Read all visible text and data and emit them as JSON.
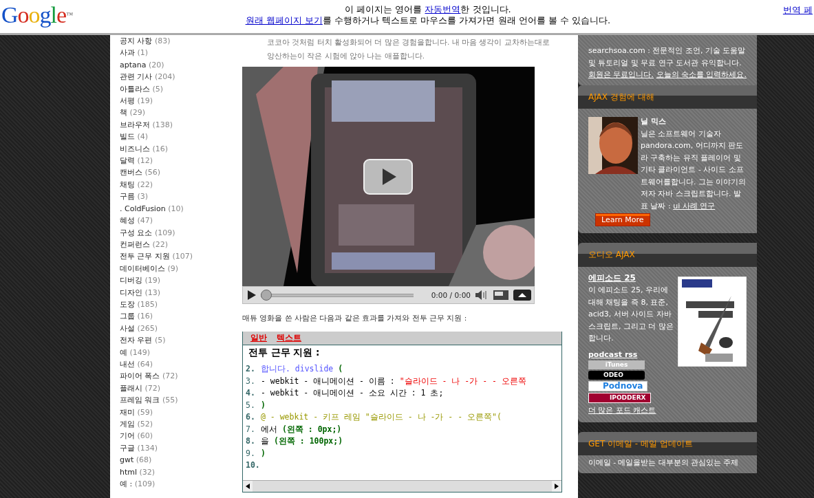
{
  "header": {
    "logo": "Google",
    "logo_mark": "™",
    "notice": [
      [
        {
          "kind": "text",
          "text": "이 페이지는 영어를 "
        },
        {
          "kind": "link",
          "text": "자동번역"
        },
        {
          "kind": "text",
          "text": "한 것입니다."
        }
      ],
      [
        {
          "kind": "link",
          "text": "원래 웹페이지 보기"
        },
        {
          "kind": "text",
          "text": "를 수행하거나 텍스트로 마우스를 가져가면 원래 언어를 볼 수 있습니다."
        }
      ]
    ],
    "right_link": "번역 페"
  },
  "categories": [
    {
      "name": "공지 사항",
      "count": "(83)"
    },
    {
      "name": "사과",
      "count": "(1)"
    },
    {
      "name": "aptana",
      "count": "(20)"
    },
    {
      "name": "관련 기사",
      "count": "(204)"
    },
    {
      "name": "아틀라스",
      "count": "(5)"
    },
    {
      "name": "서평",
      "count": "(19)"
    },
    {
      "name": "책",
      "count": "(29)"
    },
    {
      "name": "브라우저",
      "count": "(138)"
    },
    {
      "name": "빌드",
      "count": "(4)"
    },
    {
      "name": "비즈니스",
      "count": "(16)"
    },
    {
      "name": "달력",
      "count": "(12)"
    },
    {
      "name": "캔버스",
      "count": "(56)"
    },
    {
      "name": "채팅",
      "count": "(22)"
    },
    {
      "name": "구름",
      "count": "(3)"
    },
    {
      "name": ". ColdFusion",
      "count": "(10)"
    },
    {
      "name": "혜성",
      "count": "(47)"
    },
    {
      "name": "구성 요소",
      "count": "(109)"
    },
    {
      "name": "컨퍼런스",
      "count": "(22)"
    },
    {
      "name": "전투 근무 지원",
      "count": "(107)"
    },
    {
      "name": "데이터베이스",
      "count": "(9)"
    },
    {
      "name": "디버깅",
      "count": "(19)"
    },
    {
      "name": "디자인",
      "count": "(13)"
    },
    {
      "name": "도장",
      "count": "(185)"
    },
    {
      "name": "그룹",
      "count": "(16)"
    },
    {
      "name": "사설",
      "count": "(265)"
    },
    {
      "name": "전자 우편",
      "count": "(5)"
    },
    {
      "name": "예",
      "count": "(149)"
    },
    {
      "name": "내선",
      "count": "(64)"
    },
    {
      "name": "파이어 폭스",
      "count": "(72)"
    },
    {
      "name": "플래시",
      "count": "(72)"
    },
    {
      "name": "프레임 워크",
      "count": "(55)"
    },
    {
      "name": "재미",
      "count": "(59)"
    },
    {
      "name": "게임",
      "count": "(52)"
    },
    {
      "name": "기어",
      "count": "(60)"
    },
    {
      "name": "구글",
      "count": "(134)"
    },
    {
      "name": "gwt",
      "count": "(68)"
    },
    {
      "name": "html",
      "count": "(32)"
    },
    {
      "name": "예 :",
      "count": "(109)"
    }
  ],
  "article": {
    "intro": "코코아 것처럼 터치 활성화되어 더 많은 경험을합니다. 내 마음 생각이 교차하는대로 앙산하는이 작은 시험에 앉아 나는 애플합니다.",
    "video": {
      "kind": "picture",
      "time": "0:00 / 0:00",
      "progress": {
        "level": 0
      }
    },
    "caption": "매튜 영화을 쓴 사람은 다음과 같은 효과를 가져와 전투 근무 지원 :",
    "code": {
      "tabs": [
        "일반",
        "텍스트"
      ],
      "title": "전투 근무 지원 :",
      "lines": [
        {
          "number": "2.",
          "segments": [
            {
              "kind": "keyword",
              "text": "합니다. divslide"
            },
            {
              "kind": "value",
              "text": " ("
            }
          ]
        },
        {
          "number": "3.",
          "segments": [
            {
              "kind": "plain",
              "text": "- webkit - 애니메이션 - 이름 : "
            },
            {
              "kind": "string",
              "text": "\"슬라이드 - 나 -가 - - 오른쪽"
            }
          ]
        },
        {
          "number": "4.",
          "segments": [
            {
              "kind": "plain",
              "text": "- webkit - 애니메이션 - 소요 시간 : 1 초;"
            }
          ]
        },
        {
          "number": "5.",
          "segments": [
            {
              "kind": "value",
              "text": ")"
            }
          ]
        },
        {
          "number": "6.",
          "segments": [
            {
              "kind": "atrule",
              "text": "@ - webkit - 키프 레임 \"슬라이드 - 나 -가 - - 오른쪽\"("
            }
          ]
        },
        {
          "number": "7.",
          "segments": [
            {
              "kind": "plain",
              "text": "에서 "
            },
            {
              "kind": "value",
              "text": "(왼쪽 : 0px;)"
            }
          ]
        },
        {
          "number": "8.",
          "segments": [
            {
              "kind": "plain",
              "text": "을 "
            },
            {
              "kind": "value",
              "text": "(왼쪽 : 100px;)"
            }
          ]
        },
        {
          "number": "9.",
          "segments": [
            {
              "kind": "value",
              "text": ")"
            }
          ]
        },
        {
          "number": "10."
        }
      ]
    }
  },
  "sidebar": {
    "intro": [
      {
        "kind": "text",
        "text": "searchsoa.com : 전문적인 조언, 기술 도움말 및 튜토리얼 및 무료 연구 도서관 유익합니다. "
      },
      {
        "kind": "link",
        "text": "회원은 무료입니다."
      },
      {
        "kind": "link",
        "text": "오늘의 숙소를 입력하세요."
      }
    ],
    "about": {
      "title": "AJAX 경험에 대해",
      "name": "닐 믹스",
      "bio": [
        {
          "kind": "text",
          "text": "닐은 소프트웨어 기술자 pandora.com, 어디까지 판도라 구축하는 뮤직 플레이어 및 기타 클라이언트 - 사이드 소프트웨어를합니다. 그는 이야기의 저자 자바 스크립트합니다. 발표 날짜 : "
        },
        {
          "kind": "link",
          "text": "ui 사례 연구"
        }
      ],
      "button": "Learn More"
    },
    "audio": {
      "title": "오디오 AJAX",
      "episode": "에피소드 25",
      "text": "이 에피소드 25, 우리에 대해 채팅을 즉 8, 표준, acid3, 서버 사이드 자바 스크립트, 그리고 더 많은합니다.",
      "rss": "podcast rss",
      "badges": [
        {
          "kind": "itunes",
          "text": "iTunes"
        },
        {
          "kind": "odeo",
          "text": "ODEO"
        },
        {
          "kind": "podnova",
          "text": "Podnova"
        },
        {
          "kind": "ipodderx",
          "text": "IPODDERX"
        }
      ],
      "more": "더 많은 포드 캐스트"
    },
    "email": {
      "title": "GET 이메일 - 메일 업데이트",
      "text": "이메일 - 메일을받는 대부분의 관심있는 주제"
    }
  }
}
